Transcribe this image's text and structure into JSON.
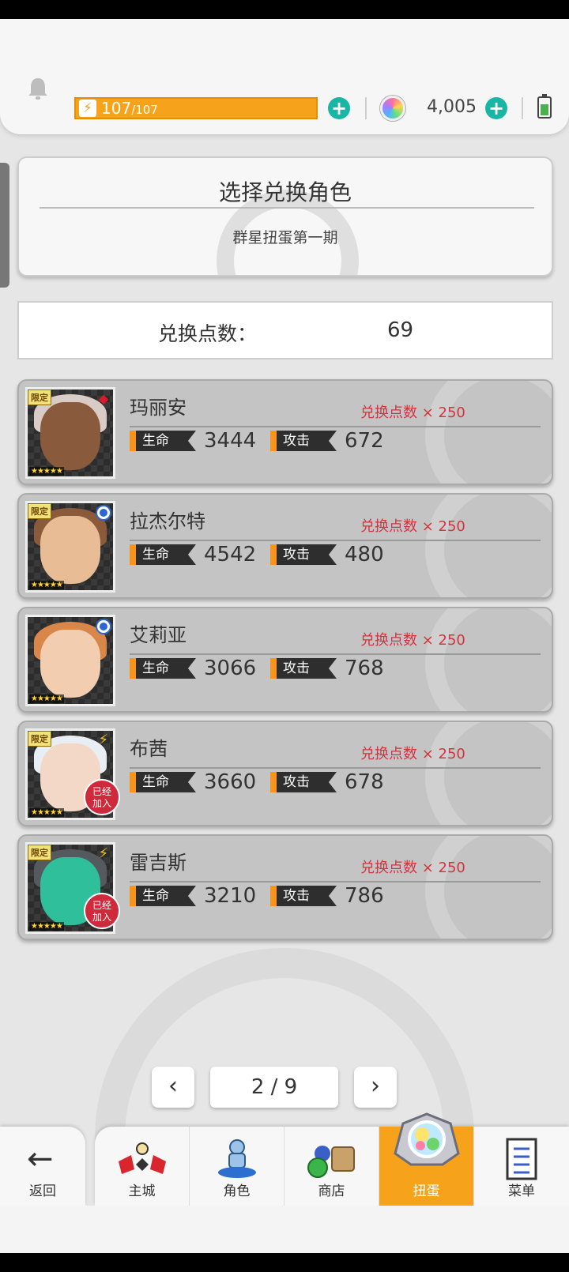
{
  "status": {
    "energy_current": "107",
    "energy_max": "/107",
    "energy_percent": 100,
    "gems": "4,005",
    "plus_symbol": "+",
    "energy_symbol": "⚡"
  },
  "header": {
    "title": "选择兑换角色",
    "subtitle": "群星扭蛋第一期"
  },
  "points": {
    "label": "兑换点数：",
    "value": "69"
  },
  "characters": [
    {
      "name": "玛丽安",
      "cost": "兑换点数 × 250",
      "hp_label": "生命值",
      "hp": "3444",
      "atk_label": "攻击",
      "atk": "672",
      "limited": "限定",
      "stars": "★★★★★",
      "element": "red-diamond-icon",
      "element_glyph": "◆",
      "joined": false,
      "hair_color": "#d9cbc6",
      "skin_color": "#8a5a3c"
    },
    {
      "name": "拉杰尔特",
      "cost": "兑换点数 × 250",
      "hp_label": "生命值",
      "hp": "4542",
      "atk_label": "攻击",
      "atk": "480",
      "limited": "限定",
      "stars": "★★★★★",
      "element": "blue-orb-icon",
      "element_glyph": "",
      "joined": false,
      "hair_color": "#8a5a3a",
      "skin_color": "#e8bd96"
    },
    {
      "name": "艾莉亚",
      "cost": "兑换点数 × 250",
      "hp_label": "生命值",
      "hp": "3066",
      "atk_label": "攻击",
      "atk": "768",
      "limited": "",
      "stars": "★★★★★",
      "element": "blue-orb-icon",
      "element_glyph": "",
      "joined": false,
      "hair_color": "#d9864a",
      "skin_color": "#f3cdb0"
    },
    {
      "name": "布茜",
      "cost": "兑换点数 × 250",
      "hp_label": "生命值",
      "hp": "3660",
      "atk_label": "攻击",
      "atk": "678",
      "limited": "限定",
      "stars": "★★★★★",
      "element": "lightning-icon",
      "element_glyph": "⚡",
      "joined": true,
      "joined_text_1": "已经",
      "joined_text_2": "加入",
      "hair_color": "#e8eef3",
      "skin_color": "#f3d8c8"
    },
    {
      "name": "雷吉斯",
      "cost": "兑换点数 × 250",
      "hp_label": "生命值",
      "hp": "3210",
      "atk_label": "攻击",
      "atk": "786",
      "limited": "限定",
      "stars": "★★★★★",
      "element": "lightning-icon",
      "element_glyph": "⚡",
      "joined": true,
      "joined_text_1": "已经",
      "joined_text_2": "加入",
      "hair_color": "#555a5e",
      "skin_color": "#2fbf9a"
    }
  ],
  "pagination": {
    "prev": "‹",
    "next": "›",
    "current": "2 / 9"
  },
  "nav": {
    "back": "返回",
    "back_arrow": "←",
    "tabs": [
      {
        "label": "主城",
        "icon": "castle-icon",
        "active": false
      },
      {
        "label": "角色",
        "icon": "character-icon",
        "active": false
      },
      {
        "label": "商店",
        "icon": "shop-icon",
        "active": false
      },
      {
        "label": "扭蛋",
        "icon": "gacha-icon",
        "active": true
      },
      {
        "label": "菜单",
        "icon": "menu-icon",
        "active": false
      }
    ]
  },
  "colors": {
    "accent": "#f7a21b",
    "teal": "#19b5a5",
    "cost_red": "#d2343d"
  }
}
